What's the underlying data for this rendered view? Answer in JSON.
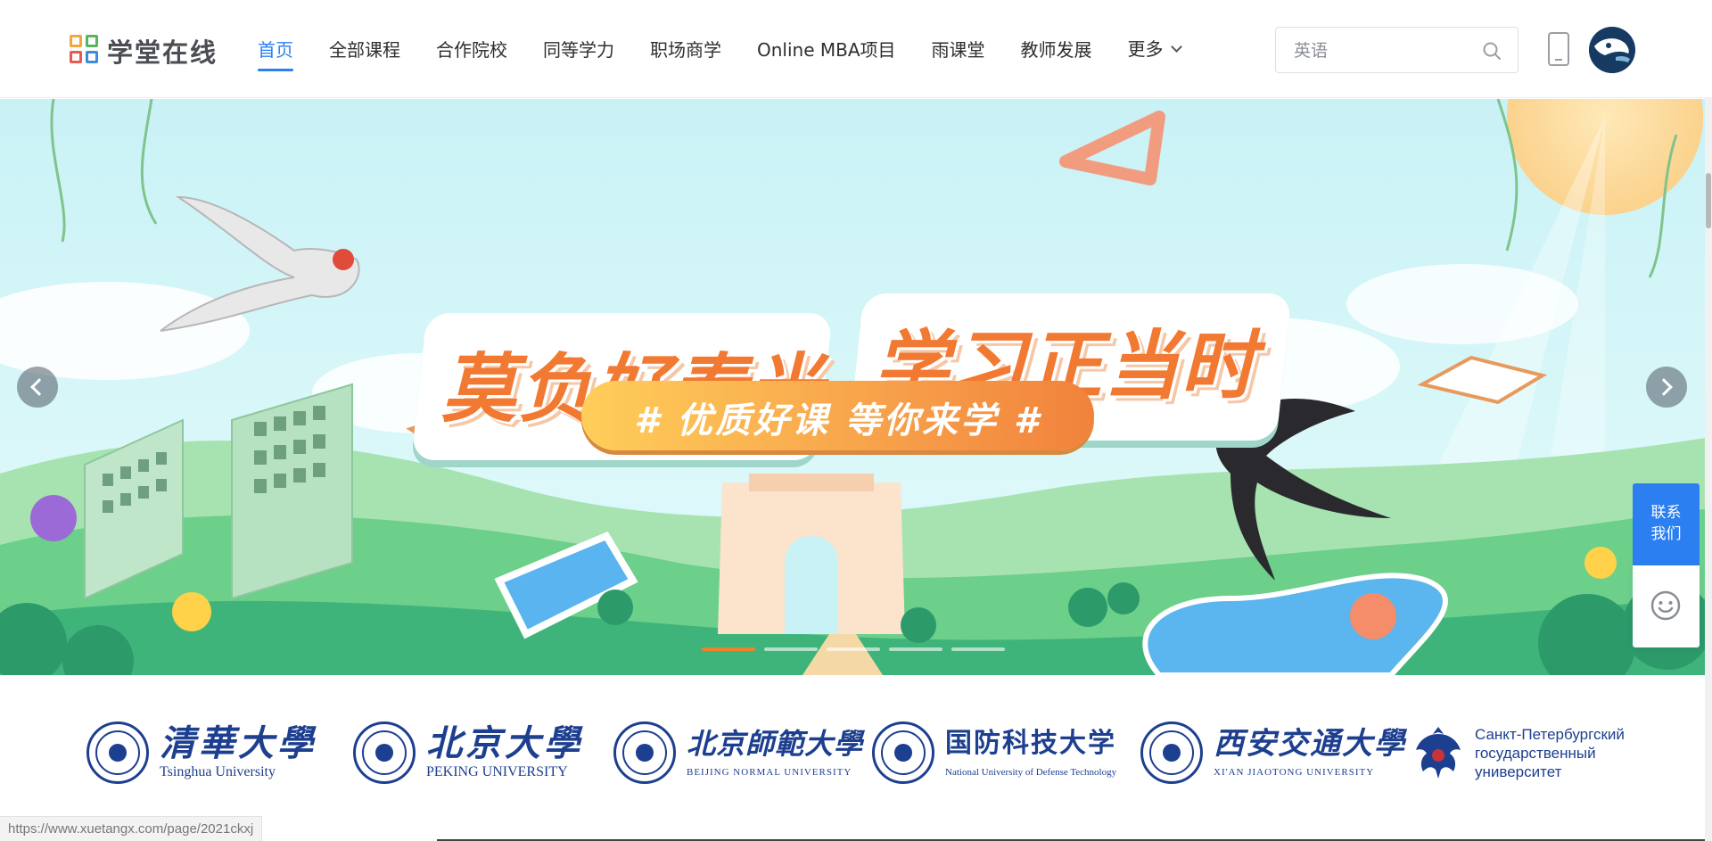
{
  "logo": {
    "text": "学堂在线"
  },
  "nav": {
    "items": [
      {
        "label": "首页",
        "active": true
      },
      {
        "label": "全部课程"
      },
      {
        "label": "合作院校"
      },
      {
        "label": "同等学力"
      },
      {
        "label": "职场商学"
      },
      {
        "label": "Online MBA项目"
      },
      {
        "label": "雨课堂"
      },
      {
        "label": "教师发展"
      }
    ],
    "more_label": "更多"
  },
  "search": {
    "placeholder": "英语"
  },
  "banner": {
    "headline_left": "莫负好春光",
    "headline_right": "学习正当时",
    "slogan": "# 优质好课   等你来学 #",
    "slide_count": 5,
    "active_slide": 1
  },
  "side": {
    "contact_line1": "联系",
    "contact_line2": "我们"
  },
  "partners": [
    {
      "cn": "清華大學",
      "en": "Tsinghua University"
    },
    {
      "cn": "北京大學",
      "en": "PEKING UNIVERSITY"
    },
    {
      "cn": "北京師範大學",
      "en": "BEIJING NORMAL UNIVERSITY"
    },
    {
      "cn": "国防科技大学",
      "en": "National University of Defense Technology"
    },
    {
      "cn": "西安交通大學",
      "en": "XI'AN JIAOTONG UNIVERSITY"
    },
    {
      "ru1": "Санкт-Петербургский",
      "ru2": "государственный",
      "ru3": "университет"
    }
  ],
  "status_bar": {
    "url": "https://www.xuetangx.com/page/2021ckxj"
  },
  "colors": {
    "accent": "#2b7ff0",
    "banner_orange": "#f27932",
    "partner_blue": "#1d3f8f"
  }
}
